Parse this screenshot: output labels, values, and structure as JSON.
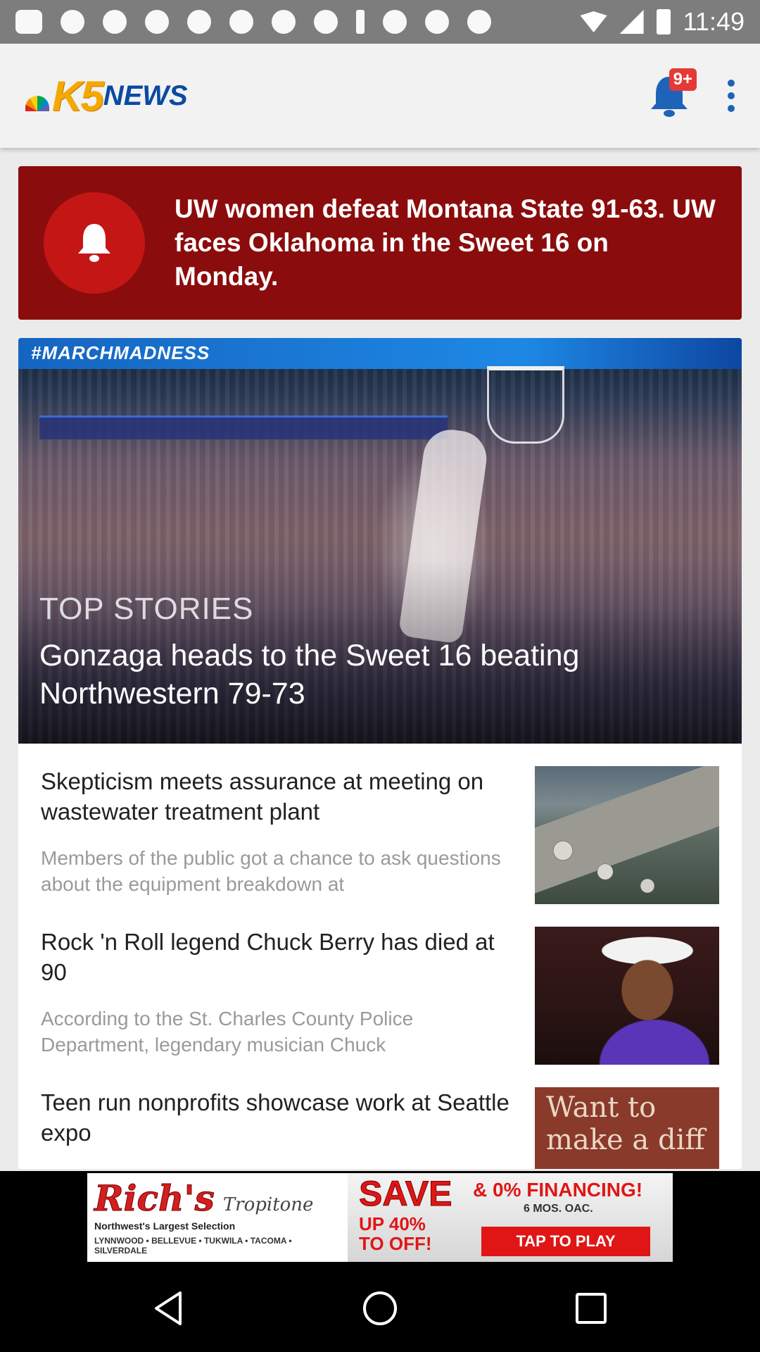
{
  "status_bar": {
    "time": "11:49"
  },
  "app_bar": {
    "logo_k5": "K5",
    "logo_news": "NEWS",
    "notification_badge": "9+",
    "accent_color": "#1f63b8"
  },
  "alert": {
    "text": "UW women defeat Montana State 91-63. UW faces Oklahoma in the Sweet 16 on Monday.",
    "color": "#8b0c0c"
  },
  "hero": {
    "banner_text": "#MARCHMADNESS",
    "kicker": "TOP STORIES",
    "title": "Gonzaga heads to the Sweet 16 beating Northwestern 79-73"
  },
  "stories": [
    {
      "title": "Skepticism meets assurance at meeting on wastewater treatment plant",
      "summary": "Members of the public got a chance to ask questions about the equipment breakdown at"
    },
    {
      "title": "Rock 'n Roll legend Chuck Berry has died at 90",
      "summary": "According to the St. Charles County Police Department, legendary musician Chuck"
    },
    {
      "title": "Teen run nonprofits showcase work at Seattle expo",
      "summary": "",
      "thumb_text": "Want to make a diff"
    }
  ],
  "ad": {
    "brand": "Rich's",
    "partner": "Tropitone",
    "tagline": "Northwest's Largest Selection",
    "cities": "LYNNWOOD • BELLEVUE • TUKWILA • TACOMA • SILVERDALE",
    "save": "SAVE",
    "financing": "& 0% FINANCING!",
    "months": "6 MOS. OAC.",
    "discount": "UP 40% TO OFF!",
    "cta": "TAP TO PLAY"
  }
}
